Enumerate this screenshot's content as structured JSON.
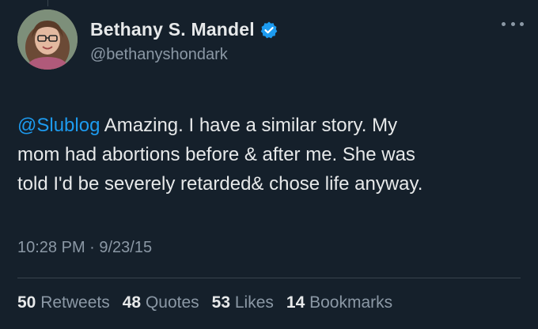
{
  "author": {
    "display_name": "Bethany S. Mandel",
    "handle": "@bethanyshondark",
    "verified_badge_color": "#1d9bf0"
  },
  "tweet": {
    "mention": "@Slublog",
    "text": " Amazing. I have a similar story. My\nmom had abortions before & after me. She was\ntold I'd be severely retarded& chose life anyway.",
    "timestamp": "10:28 PM · 9/23/15"
  },
  "stats": [
    {
      "count": "50",
      "label": "Retweets"
    },
    {
      "count": "48",
      "label": "Quotes"
    },
    {
      "count": "53",
      "label": "Likes"
    },
    {
      "count": "14",
      "label": "Bookmarks"
    }
  ],
  "colors": {
    "background": "#15202b",
    "text": "#e7e9ea",
    "muted": "#8b98a5",
    "link": "#1d9bf0",
    "divider": "#38444d"
  }
}
